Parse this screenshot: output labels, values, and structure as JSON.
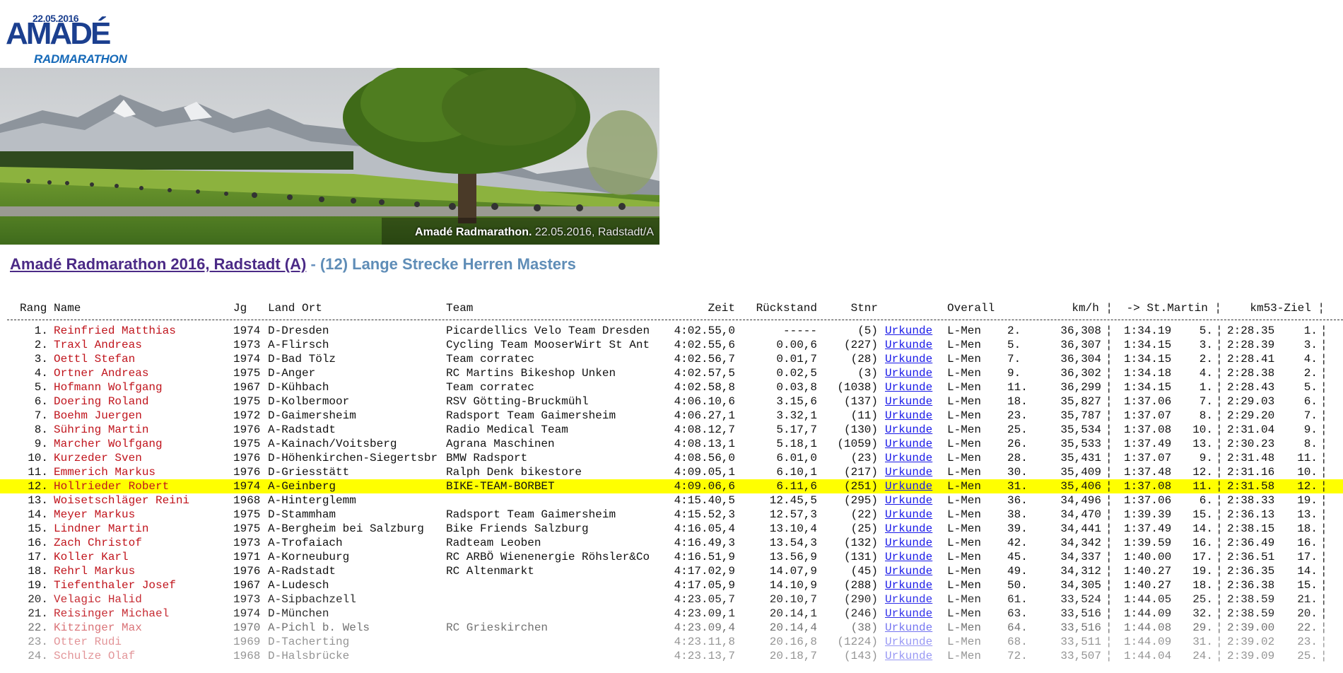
{
  "logo": {
    "date": "22.05.2016",
    "name": "AMADÉ",
    "subtitle": "RADMARATHON"
  },
  "banner": {
    "caption_bold": "Amadé Radmarathon.",
    "caption_rest": " 22.05.2016, Radstadt/A"
  },
  "heading": {
    "link_text": "Amadé Radmarathon 2016, Radstadt (A)",
    "separator": " - ",
    "category": "(12) Lange Strecke Herren Masters"
  },
  "columns": {
    "rang": "Rang",
    "name": "Name",
    "jg": "Jg",
    "land_ort": "Land Ort",
    "team": "Team",
    "zeit": "Zeit",
    "rueckstand": "Rückstand",
    "stnr": "Stnr",
    "overall": "Overall",
    "kmh": "km/h ¦",
    "stmartin": "-> St.Martin  ¦",
    "ziel": "km53-Ziel ¦"
  },
  "link_label": "Urkunde",
  "highlight_color": "#ffff00",
  "rows": [
    {
      "rang": "1.",
      "name": "Reinfried Matthias",
      "jg": "1974",
      "ort": "D-Dresden",
      "team": "Picardellics Velo Team Dresden",
      "zeit": "4:02.55,0",
      "rueck": "-----",
      "stnr": "(5)",
      "cls": "L-Men",
      "ov": "2.",
      "kmh": "36,308",
      "sm_t": "1:34.19",
      "sm_r": "5.",
      "zl_t": "2:28.35",
      "zl_r": "1."
    },
    {
      "rang": "2.",
      "name": "Traxl Andreas",
      "jg": "1973",
      "ort": "A-Flirsch",
      "team": "Cycling Team MooserWirt St Ant",
      "zeit": "4:02.55,6",
      "rueck": "0.00,6",
      "stnr": "(227)",
      "cls": "L-Men",
      "ov": "5.",
      "kmh": "36,307",
      "sm_t": "1:34.15",
      "sm_r": "3.",
      "zl_t": "2:28.39",
      "zl_r": "3."
    },
    {
      "rang": "3.",
      "name": "Oettl Stefan",
      "jg": "1974",
      "ort": "D-Bad Tölz",
      "team": "Team corratec",
      "zeit": "4:02.56,7",
      "rueck": "0.01,7",
      "stnr": "(28)",
      "cls": "L-Men",
      "ov": "7.",
      "kmh": "36,304",
      "sm_t": "1:34.15",
      "sm_r": "2.",
      "zl_t": "2:28.41",
      "zl_r": "4."
    },
    {
      "rang": "4.",
      "name": "Ortner Andreas",
      "jg": "1975",
      "ort": "D-Anger",
      "team": "RC Martins Bikeshop Unken",
      "zeit": "4:02.57,5",
      "rueck": "0.02,5",
      "stnr": "(3)",
      "cls": "L-Men",
      "ov": "9.",
      "kmh": "36,302",
      "sm_t": "1:34.18",
      "sm_r": "4.",
      "zl_t": "2:28.38",
      "zl_r": "2."
    },
    {
      "rang": "5.",
      "name": "Hofmann Wolfgang",
      "jg": "1967",
      "ort": "D-Kühbach",
      "team": "Team corratec",
      "zeit": "4:02.58,8",
      "rueck": "0.03,8",
      "stnr": "(1038)",
      "cls": "L-Men",
      "ov": "11.",
      "kmh": "36,299",
      "sm_t": "1:34.15",
      "sm_r": "1.",
      "zl_t": "2:28.43",
      "zl_r": "5."
    },
    {
      "rang": "6.",
      "name": "Doering Roland",
      "jg": "1975",
      "ort": "D-Kolbermoor",
      "team": "RSV Götting-Bruckmühl",
      "zeit": "4:06.10,6",
      "rueck": "3.15,6",
      "stnr": "(137)",
      "cls": "L-Men",
      "ov": "18.",
      "kmh": "35,827",
      "sm_t": "1:37.06",
      "sm_r": "7.",
      "zl_t": "2:29.03",
      "zl_r": "6."
    },
    {
      "rang": "7.",
      "name": "Boehm Juergen",
      "jg": "1972",
      "ort": "D-Gaimersheim",
      "team": "Radsport Team Gaimersheim",
      "zeit": "4:06.27,1",
      "rueck": "3.32,1",
      "stnr": "(11)",
      "cls": "L-Men",
      "ov": "23.",
      "kmh": "35,787",
      "sm_t": "1:37.07",
      "sm_r": "8.",
      "zl_t": "2:29.20",
      "zl_r": "7."
    },
    {
      "rang": "8.",
      "name": "Sühring Martin",
      "jg": "1976",
      "ort": "A-Radstadt",
      "team": "Radio Medical Team",
      "zeit": "4:08.12,7",
      "rueck": "5.17,7",
      "stnr": "(130)",
      "cls": "L-Men",
      "ov": "25.",
      "kmh": "35,534",
      "sm_t": "1:37.08",
      "sm_r": "10.",
      "zl_t": "2:31.04",
      "zl_r": "9."
    },
    {
      "rang": "9.",
      "name": "Marcher Wolfgang",
      "jg": "1975",
      "ort": "A-Kainach/Voitsberg",
      "team": "Agrana Maschinen",
      "zeit": "4:08.13,1",
      "rueck": "5.18,1",
      "stnr": "(1059)",
      "cls": "L-Men",
      "ov": "26.",
      "kmh": "35,533",
      "sm_t": "1:37.49",
      "sm_r": "13.",
      "zl_t": "2:30.23",
      "zl_r": "8."
    },
    {
      "rang": "10.",
      "name": "Kurzeder Sven",
      "jg": "1976",
      "ort": "D-Höhenkirchen-Siegertsbr",
      "team": "BMW Radsport",
      "zeit": "4:08.56,0",
      "rueck": "6.01,0",
      "stnr": "(23)",
      "cls": "L-Men",
      "ov": "28.",
      "kmh": "35,431",
      "sm_t": "1:37.07",
      "sm_r": "9.",
      "zl_t": "2:31.48",
      "zl_r": "11."
    },
    {
      "rang": "11.",
      "name": "Emmerich Markus",
      "jg": "1976",
      "ort": "D-Griesstätt",
      "team": "Ralph Denk bikestore",
      "zeit": "4:09.05,1",
      "rueck": "6.10,1",
      "stnr": "(217)",
      "cls": "L-Men",
      "ov": "30.",
      "kmh": "35,409",
      "sm_t": "1:37.48",
      "sm_r": "12.",
      "zl_t": "2:31.16",
      "zl_r": "10."
    },
    {
      "rang": "12.",
      "name": "Hollrieder Robert",
      "jg": "1974",
      "ort": "A-Geinberg",
      "team": "BIKE-TEAM-BORBET",
      "zeit": "4:09.06,6",
      "rueck": "6.11,6",
      "stnr": "(251)",
      "cls": "L-Men",
      "ov": "31.",
      "kmh": "35,406",
      "sm_t": "1:37.08",
      "sm_r": "11.",
      "zl_t": "2:31.58",
      "zl_r": "12.",
      "highlight": true
    },
    {
      "rang": "13.",
      "name": "Woisetschläger Reini",
      "jg": "1968",
      "ort": "A-Hinterglemm",
      "team": "",
      "zeit": "4:15.40,5",
      "rueck": "12.45,5",
      "stnr": "(295)",
      "cls": "L-Men",
      "ov": "36.",
      "kmh": "34,496",
      "sm_t": "1:37.06",
      "sm_r": "6.",
      "zl_t": "2:38.33",
      "zl_r": "19."
    },
    {
      "rang": "14.",
      "name": "Meyer Markus",
      "jg": "1975",
      "ort": "D-Stammham",
      "team": "Radsport Team Gaimersheim",
      "zeit": "4:15.52,3",
      "rueck": "12.57,3",
      "stnr": "(22)",
      "cls": "L-Men",
      "ov": "38.",
      "kmh": "34,470",
      "sm_t": "1:39.39",
      "sm_r": "15.",
      "zl_t": "2:36.13",
      "zl_r": "13."
    },
    {
      "rang": "15.",
      "name": "Lindner Martin",
      "jg": "1975",
      "ort": "A-Bergheim bei Salzburg",
      "team": "Bike Friends Salzburg",
      "zeit": "4:16.05,4",
      "rueck": "13.10,4",
      "stnr": "(25)",
      "cls": "L-Men",
      "ov": "39.",
      "kmh": "34,441",
      "sm_t": "1:37.49",
      "sm_r": "14.",
      "zl_t": "2:38.15",
      "zl_r": "18."
    },
    {
      "rang": "16.",
      "name": "Zach Christof",
      "jg": "1973",
      "ort": "A-Trofaiach",
      "team": "Radteam Leoben",
      "zeit": "4:16.49,3",
      "rueck": "13.54,3",
      "stnr": "(132)",
      "cls": "L-Men",
      "ov": "42.",
      "kmh": "34,342",
      "sm_t": "1:39.59",
      "sm_r": "16.",
      "zl_t": "2:36.49",
      "zl_r": "16."
    },
    {
      "rang": "17.",
      "name": "Koller Karl",
      "jg": "1971",
      "ort": "A-Korneuburg",
      "team": "RC ARBÖ Wienenergie Röhsler&Co",
      "zeit": "4:16.51,9",
      "rueck": "13.56,9",
      "stnr": "(131)",
      "cls": "L-Men",
      "ov": "45.",
      "kmh": "34,337",
      "sm_t": "1:40.00",
      "sm_r": "17.",
      "zl_t": "2:36.51",
      "zl_r": "17."
    },
    {
      "rang": "18.",
      "name": "Rehrl Markus",
      "jg": "1976",
      "ort": "A-Radstadt",
      "team": "RC Altenmarkt",
      "zeit": "4:17.02,9",
      "rueck": "14.07,9",
      "stnr": "(45)",
      "cls": "L-Men",
      "ov": "49.",
      "kmh": "34,312",
      "sm_t": "1:40.27",
      "sm_r": "19.",
      "zl_t": "2:36.35",
      "zl_r": "14."
    },
    {
      "rang": "19.",
      "name": "Tiefenthaler Josef",
      "jg": "1967",
      "ort": "A-Ludesch",
      "team": "",
      "zeit": "4:17.05,9",
      "rueck": "14.10,9",
      "stnr": "(288)",
      "cls": "L-Men",
      "ov": "50.",
      "kmh": "34,305",
      "sm_t": "1:40.27",
      "sm_r": "18.",
      "zl_t": "2:36.38",
      "zl_r": "15."
    },
    {
      "rang": "20.",
      "name": "Velagic Halid",
      "jg": "1973",
      "ort": "A-Sipbachzell",
      "team": "",
      "zeit": "4:23.05,7",
      "rueck": "20.10,7",
      "stnr": "(290)",
      "cls": "L-Men",
      "ov": "61.",
      "kmh": "33,524",
      "sm_t": "1:44.05",
      "sm_r": "25.",
      "zl_t": "2:38.59",
      "zl_r": "21.",
      "fade": 1
    },
    {
      "rang": "21.",
      "name": "Reisinger Michael",
      "jg": "1974",
      "ort": "D-München",
      "team": "",
      "zeit": "4:23.09,1",
      "rueck": "20.14,1",
      "stnr": "(246)",
      "cls": "L-Men",
      "ov": "63.",
      "kmh": "33,516",
      "sm_t": "1:44.09",
      "sm_r": "32.",
      "zl_t": "2:38.59",
      "zl_r": "20.",
      "fade": 1
    },
    {
      "rang": "22.",
      "name": "Kitzinger Max",
      "jg": "1970",
      "ort": "A-Pichl b. Wels",
      "team": "RC Grieskirchen",
      "zeit": "4:23.09,4",
      "rueck": "20.14,4",
      "stnr": "(38)",
      "cls": "L-Men",
      "ov": "64.",
      "kmh": "33,516",
      "sm_t": "1:44.08",
      "sm_r": "29.",
      "zl_t": "2:39.00",
      "zl_r": "22.",
      "fade": 2
    },
    {
      "rang": "23.",
      "name": "Otter Rudi",
      "jg": "1969",
      "ort": "D-Tacherting",
      "team": "",
      "zeit": "4:23.11,8",
      "rueck": "20.16,8",
      "stnr": "(1224)",
      "cls": "L-Men",
      "ov": "68.",
      "kmh": "33,511",
      "sm_t": "1:44.09",
      "sm_r": "31.",
      "zl_t": "2:39.02",
      "zl_r": "23.",
      "fade": 3
    },
    {
      "rang": "24.",
      "name": "Schulze Olaf",
      "jg": "1968",
      "ort": "D-Halsbrücke",
      "team": "",
      "zeit": "4:23.13,7",
      "rueck": "20.18,7",
      "stnr": "(143)",
      "cls": "L-Men",
      "ov": "72.",
      "kmh": "33,507",
      "sm_t": "1:44.04",
      "sm_r": "24.",
      "zl_t": "2:39.09",
      "zl_r": "25.",
      "fade": 3
    }
  ]
}
